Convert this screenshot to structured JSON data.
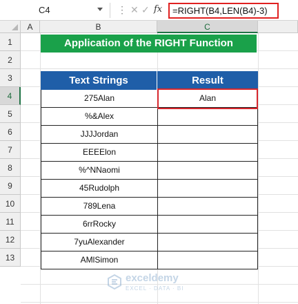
{
  "name_box": {
    "value": "C4"
  },
  "formula_bar": {
    "fx_label": "fx",
    "formula": "=RIGHT(B4,LEN(B4)-3)"
  },
  "columns": [
    "A",
    "B",
    "C"
  ],
  "rows": [
    "1",
    "2",
    "3",
    "4",
    "5",
    "6",
    "7",
    "8",
    "9",
    "10",
    "11",
    "12",
    "13"
  ],
  "selected_cell": {
    "column": "C",
    "row": "4"
  },
  "sheet": {
    "title": "Application of the RIGHT Function",
    "headers": {
      "text_strings": "Text Strings",
      "result": "Result"
    },
    "rows": [
      {
        "text": "275Alan",
        "result": "Alan"
      },
      {
        "text": "%&Alex",
        "result": ""
      },
      {
        "text": "JJJJordan",
        "result": ""
      },
      {
        "text": "EEEElon",
        "result": ""
      },
      {
        "text": "%^NNaomi",
        "result": ""
      },
      {
        "text": "45Rudolph",
        "result": ""
      },
      {
        "text": "789Lena",
        "result": ""
      },
      {
        "text": "6rrRocky",
        "result": ""
      },
      {
        "text": "7yuAlexander",
        "result": ""
      },
      {
        "text": "AMlSimon",
        "result": ""
      }
    ]
  },
  "watermark": {
    "name": "exceldemy",
    "tagline": "EXCEL · DATA · BI"
  },
  "colors": {
    "title_bg": "#1aa14a",
    "header_bg": "#1f5ea8",
    "selection": "#d7262c",
    "excel_green": "#217346"
  }
}
